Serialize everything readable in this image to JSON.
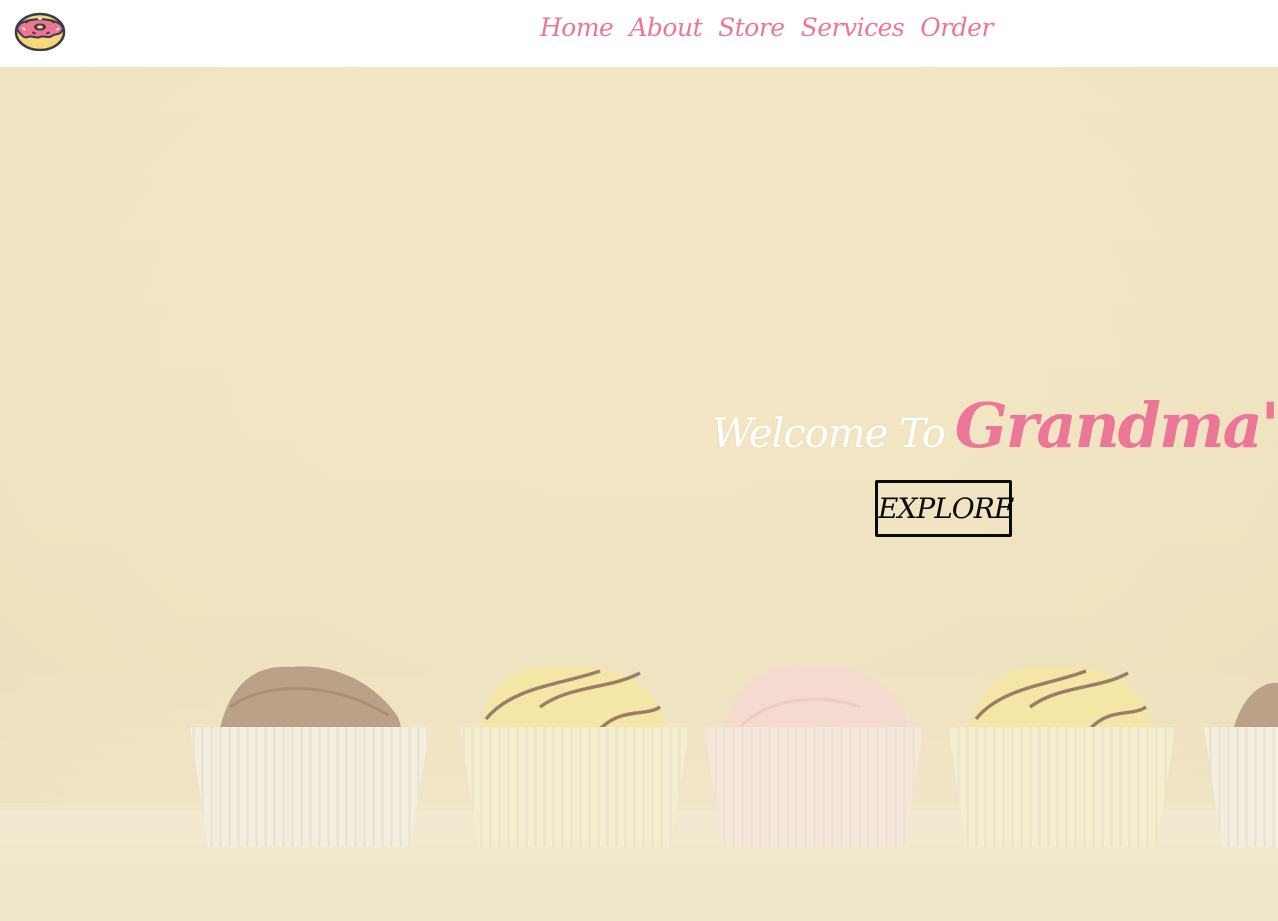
{
  "header": {
    "logo_icon": "donut-icon",
    "nav": [
      {
        "label": "Home"
      },
      {
        "label": "About"
      },
      {
        "label": "Store"
      },
      {
        "label": "Services"
      },
      {
        "label": "Order"
      }
    ]
  },
  "hero": {
    "welcome_prefix": "Welcome To",
    "brand_name": "Grandma's",
    "explore_label": "EXPLORE",
    "background_icon": "cupcakes-photo"
  },
  "colors": {
    "accent_pink": "#ec7698",
    "hero_cream": "#f1e3c0",
    "text_dark": "#0a0a0a",
    "white": "#ffffff"
  }
}
